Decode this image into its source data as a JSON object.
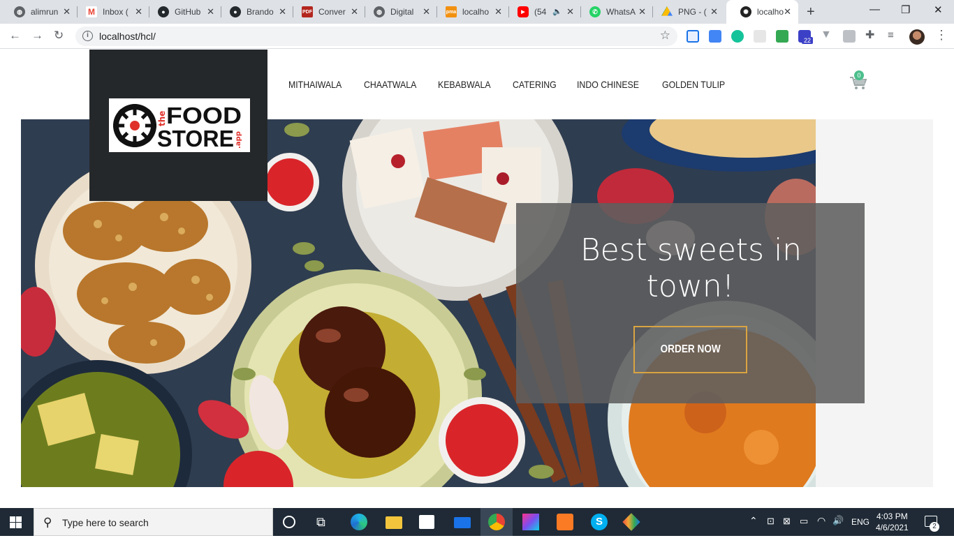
{
  "browser": {
    "tabs": [
      {
        "label": "alimrun",
        "icon": "globe-icon",
        "color": "#5f6368"
      },
      {
        "label": "Inbox (",
        "icon": "gmail-icon",
        "color": "#ea4335"
      },
      {
        "label": "GitHub",
        "icon": "github-icon",
        "color": "#24292e"
      },
      {
        "label": "Brando",
        "icon": "github-icon",
        "color": "#24292e"
      },
      {
        "label": "Conver",
        "icon": "pdf-icon",
        "color": "#b3261e"
      },
      {
        "label": "Digital",
        "icon": "globe-icon",
        "color": "#5f6368"
      },
      {
        "label": "localho",
        "icon": "phpmyadmin-icon",
        "color": "#f29111"
      },
      {
        "label": "(54",
        "icon": "youtube-icon",
        "color": "#ff0000"
      },
      {
        "label": "WhatsA",
        "icon": "whatsapp-icon",
        "color": "#25d366"
      },
      {
        "label": "PNG - (",
        "icon": "drive-icon",
        "color": "#fbbc04"
      },
      {
        "label": "localho",
        "icon": "foodstore-icon",
        "color": "#222222"
      }
    ],
    "new_tab": "+",
    "window_controls": {
      "minimize": "—",
      "restore": "❐",
      "close": "✕"
    },
    "url": "localhost/hcl/"
  },
  "site": {
    "brand": {
      "the": "the",
      "food": "FOOD",
      "store": "STORE",
      "app": ".app"
    },
    "nav": [
      "MITHAIWALA",
      "CHAATWALA",
      "KEBABWALA",
      "CATERING",
      "INDO CHINESE",
      "GOLDEN TULIP"
    ],
    "cart_count": "0",
    "hero": {
      "title_line1": "Best sweets in",
      "title_line2": "town!",
      "cta": "ORDER NOW"
    },
    "colors": {
      "accent": "#d9a441",
      "cart_badge": "#4cbf8c",
      "logo_red": "#e0302a"
    }
  },
  "taskbar": {
    "search_placeholder": "Type here to search",
    "language": "ENG",
    "time": "4:03 PM",
    "date": "4/6/2021",
    "notifications": "2"
  }
}
